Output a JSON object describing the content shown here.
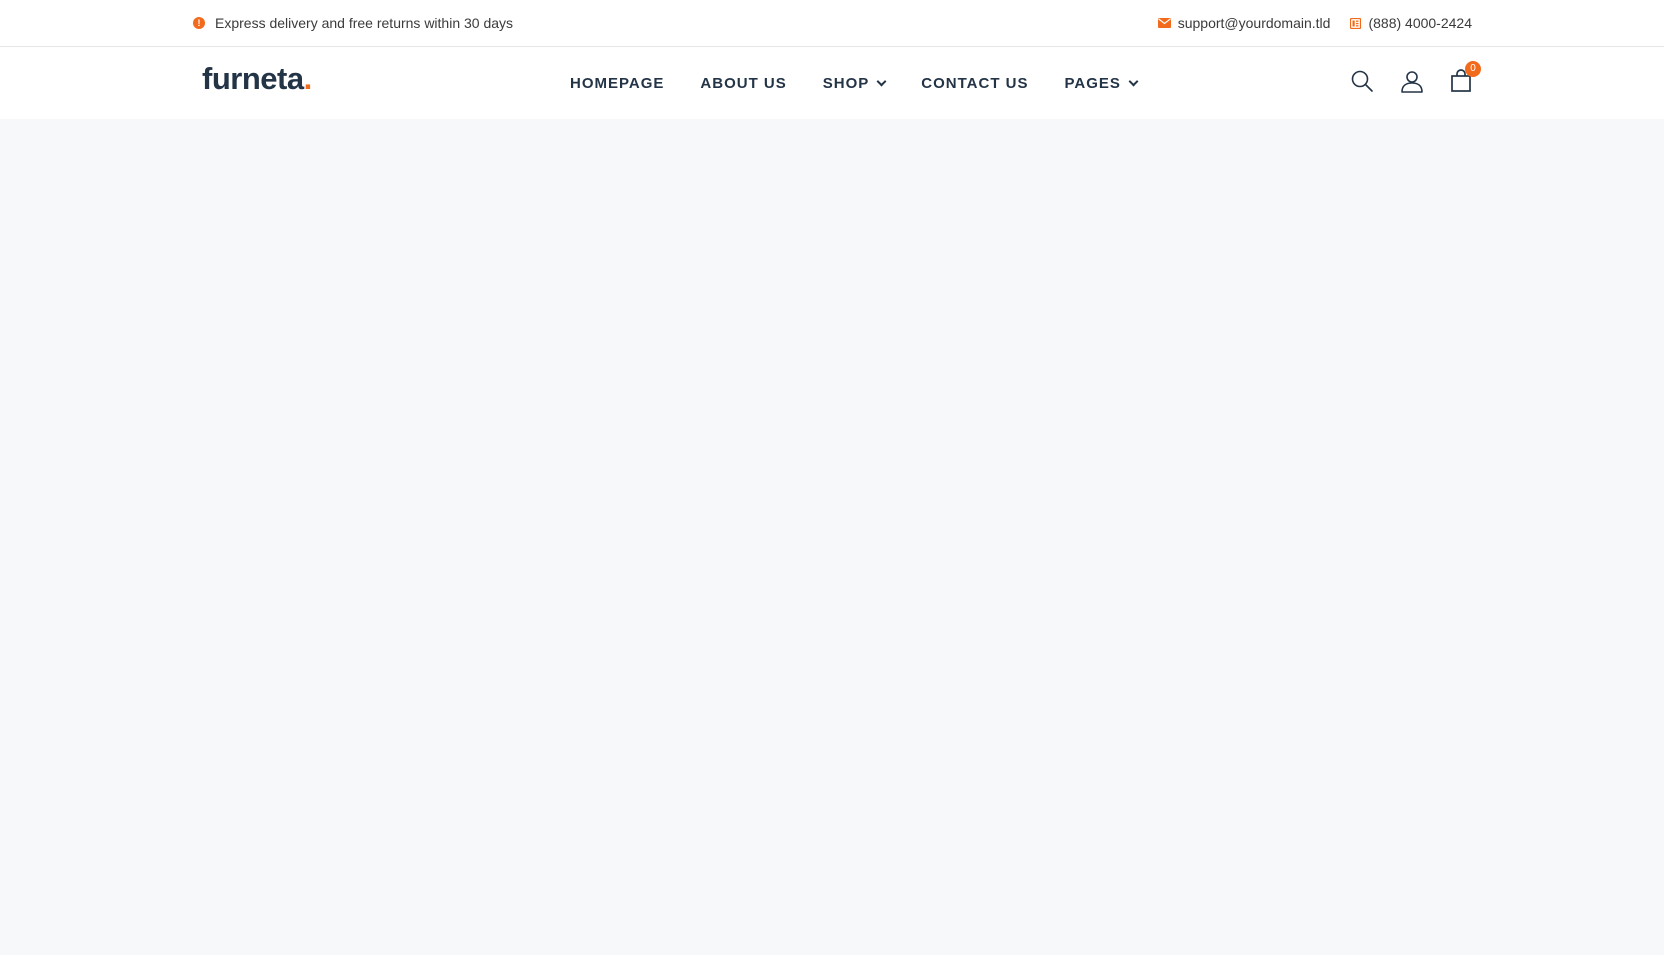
{
  "topbar": {
    "notice": "Express delivery and free returns within 30 days",
    "notice_icon": "info-icon",
    "email": "support@yourdomain.tld",
    "email_icon": "mail-icon",
    "phone": "(888) 4000-2424",
    "phone_icon": "phone-icon"
  },
  "header": {
    "logo_text": "furneta",
    "logo_dot": ".",
    "nav": [
      {
        "label": "HOMEPAGE",
        "has_dropdown": false
      },
      {
        "label": "ABOUT US",
        "has_dropdown": false
      },
      {
        "label": "SHOP",
        "has_dropdown": true
      },
      {
        "label": "CONTACT US",
        "has_dropdown": false
      },
      {
        "label": "PAGES",
        "has_dropdown": true
      }
    ],
    "icons": [
      "search-icon",
      "user-icon",
      "cart-icon"
    ],
    "cart_count": "0"
  },
  "colors": {
    "accent": "#f26b1d",
    "text_dark": "#243447",
    "background": "#f7f8fa"
  }
}
